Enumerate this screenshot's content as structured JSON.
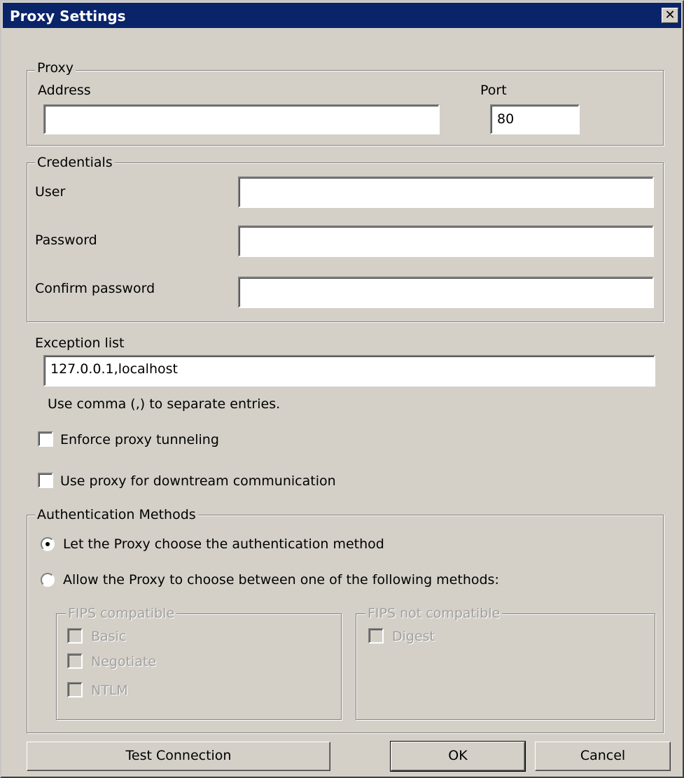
{
  "window": {
    "title": "Proxy Settings",
    "close_glyph": "✕"
  },
  "proxy": {
    "legend": "Proxy",
    "address_label": "Address",
    "address_value": "",
    "port_label": "Port",
    "port_value": "80"
  },
  "credentials": {
    "legend": "Credentials",
    "user_label": "User",
    "user_value": "",
    "password_label": "Password",
    "password_value": "",
    "confirm_label": "Confirm password",
    "confirm_value": ""
  },
  "exceptions": {
    "label": "Exception list",
    "value": "127.0.0.1,localhost",
    "hint": "Use comma (,) to separate entries."
  },
  "options": {
    "enforce_tunneling_label": "Enforce proxy tunneling",
    "enforce_tunneling_checked": false,
    "downstream_label": "Use proxy for downtream communication",
    "downstream_checked": false
  },
  "auth": {
    "legend": "Authentication Methods",
    "radio_auto_label": "Let the Proxy choose the authentication method",
    "radio_auto_selected": true,
    "radio_choose_label": "Allow the Proxy to choose between one of the following methods:",
    "radio_choose_selected": false,
    "fips_compatible": {
      "legend": "FIPS compatible",
      "items": [
        "Basic",
        "Negotiate",
        "NTLM"
      ]
    },
    "fips_not_compatible": {
      "legend": "FIPS not compatible",
      "items": [
        "Digest"
      ]
    }
  },
  "buttons": {
    "test_connection": "Test Connection",
    "ok": "OK",
    "cancel": "Cancel"
  },
  "colors": {
    "titlebar": "#0a246a",
    "dialog_bg": "#d4d0c8",
    "disabled_text": "#a0a0a0"
  }
}
